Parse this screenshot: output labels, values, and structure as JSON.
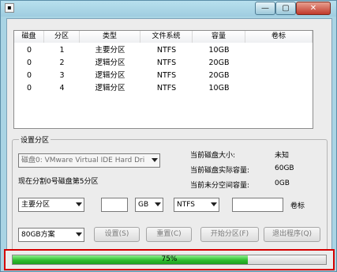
{
  "window": {
    "app_icon": "document-icon",
    "min_symbol": "—",
    "max_symbol": "▢",
    "close_symbol": "✕"
  },
  "table": {
    "headers": [
      "磁盘",
      "分区",
      "类型",
      "文件系统",
      "容量",
      "卷标"
    ],
    "rows": [
      [
        "0",
        "1",
        "主要分区",
        "NTFS",
        "10GB",
        ""
      ],
      [
        "0",
        "2",
        "逻辑分区",
        "NTFS",
        "20GB",
        ""
      ],
      [
        "0",
        "3",
        "逻辑分区",
        "NTFS",
        "20GB",
        ""
      ],
      [
        "0",
        "4",
        "逻辑分区",
        "NTFS",
        "10GB",
        ""
      ]
    ]
  },
  "settings": {
    "title": "设置分区",
    "disk_select": "磁盘0: VMware Virtual IDE Hard Dri",
    "status_line": "现在分割0号磁盘第5分区",
    "disk_size_label": "当前磁盘大小:",
    "disk_size_value": "未知",
    "actual_capacity_label": "当前磁盘实际容量:",
    "actual_capacity_value": "60GB",
    "unallocated_label": "当前未分空间容量:",
    "unallocated_value": "0GB",
    "partition_type": "主要分区",
    "size_value": "",
    "unit": "GB",
    "filesystem": "NTFS",
    "volume_label_value": "",
    "volume_label_caption": "卷标",
    "scheme": "80GB方案",
    "buttons": {
      "set": "设置(S)",
      "reset": "重置(C)",
      "start": "开始分区(F)",
      "exit": "退出程序(Q)"
    }
  },
  "progress": {
    "percent": 75,
    "label": "75%",
    "bar_color": "#2ebd2e"
  }
}
